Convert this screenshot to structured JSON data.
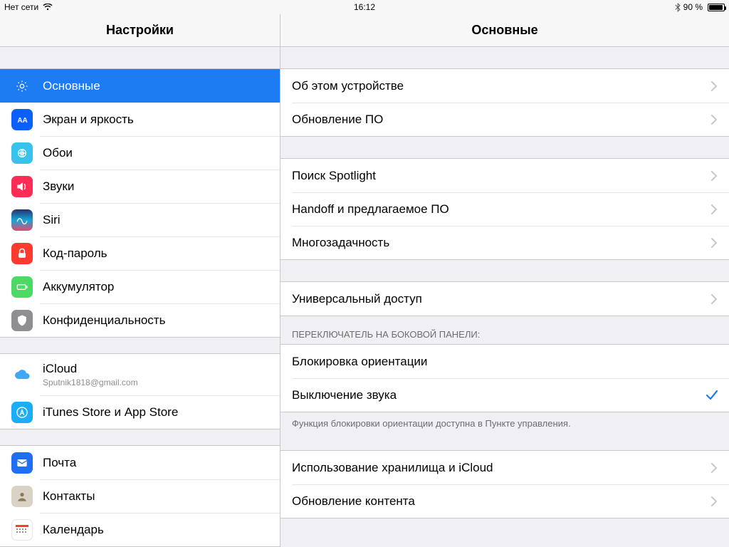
{
  "status": {
    "carrier": "Нет сети",
    "time": "16:12",
    "battery_text": "90 %"
  },
  "sidebar": {
    "title": "Настройки",
    "items": [
      {
        "id": "general",
        "label": "Основные",
        "selected": true
      },
      {
        "id": "display",
        "label": "Экран и яркость",
        "selected": false
      },
      {
        "id": "wallpaper",
        "label": "Обои",
        "selected": false
      },
      {
        "id": "sounds",
        "label": "Звуки",
        "selected": false
      },
      {
        "id": "siri",
        "label": "Siri",
        "selected": false
      },
      {
        "id": "passcode",
        "label": "Код-пароль",
        "selected": false
      },
      {
        "id": "battery",
        "label": "Аккумулятор",
        "selected": false
      },
      {
        "id": "privacy",
        "label": "Конфиденциальность",
        "selected": false
      }
    ],
    "items2": [
      {
        "id": "icloud",
        "label": "iCloud",
        "sub": "Sputnik1818@gmail.com"
      },
      {
        "id": "store",
        "label": "iTunes Store и App Store"
      }
    ],
    "items3": [
      {
        "id": "mail",
        "label": "Почта"
      },
      {
        "id": "contacts",
        "label": "Контакты"
      },
      {
        "id": "calendar",
        "label": "Календарь"
      }
    ]
  },
  "detail": {
    "title": "Основные",
    "group1": [
      {
        "id": "about",
        "label": "Об этом устройстве"
      },
      {
        "id": "update",
        "label": "Обновление ПО"
      }
    ],
    "group2": [
      {
        "id": "spotlight",
        "label": "Поиск Spotlight"
      },
      {
        "id": "handoff",
        "label": "Handoff и предлагаемое ПО"
      },
      {
        "id": "multitask",
        "label": "Многозадачность"
      }
    ],
    "group3": [
      {
        "id": "accessibility",
        "label": "Универсальный доступ"
      }
    ],
    "switch_header": "ПЕРЕКЛЮЧАТЕЛЬ НА БОКОВОЙ ПАНЕЛИ:",
    "group4": [
      {
        "id": "lock-rotation",
        "label": "Блокировка ориентации",
        "checked": false
      },
      {
        "id": "mute",
        "label": "Выключение звука",
        "checked": true
      }
    ],
    "switch_footer": "Функция блокировки ориентации доступна в Пункте управления.",
    "group5": [
      {
        "id": "storage",
        "label": "Использование хранилища и iCloud"
      },
      {
        "id": "bg-refresh",
        "label": "Обновление контента"
      }
    ]
  }
}
